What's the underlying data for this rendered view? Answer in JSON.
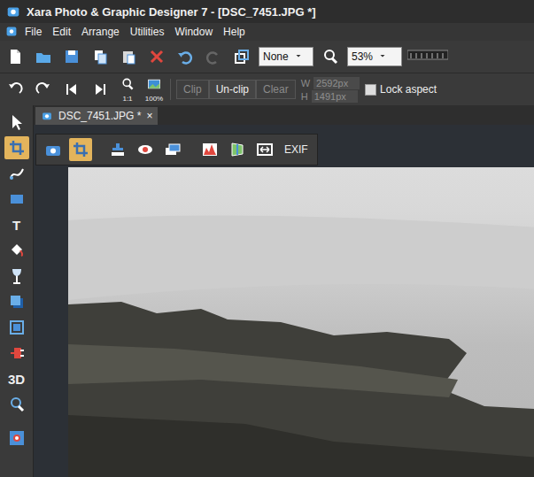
{
  "window": {
    "title": "Xara Photo & Graphic Designer 7 - [DSC_7451.JPG *]"
  },
  "menu": [
    "File",
    "Edit",
    "Arrange",
    "Utilities",
    "Window",
    "Help"
  ],
  "toolbar": {
    "quality": "None",
    "zoom": "53%"
  },
  "photo_bar": {
    "nav_labels": [
      "1:1",
      "100%"
    ],
    "buttons": [
      {
        "label": "Clip",
        "disabled": true
      },
      {
        "label": "Un-clip",
        "disabled": false
      },
      {
        "label": "Clear",
        "disabled": true
      }
    ],
    "width": {
      "label": "W",
      "value": "2592px"
    },
    "height": {
      "label": "H",
      "value": "1491px"
    },
    "lock_aspect": {
      "label": "Lock aspect",
      "checked": false
    }
  },
  "tools": [
    {
      "kind": "selector",
      "selected": false
    },
    {
      "kind": "photo",
      "selected": true
    },
    {
      "kind": "freehand",
      "selected": false
    },
    {
      "kind": "rectangle",
      "selected": false
    },
    {
      "kind": "text",
      "label": "T",
      "selected": false
    },
    {
      "kind": "fill",
      "selected": false
    },
    {
      "kind": "transparency",
      "selected": false
    },
    {
      "kind": "shadow",
      "selected": false
    },
    {
      "kind": "contour",
      "selected": false
    },
    {
      "kind": "mould",
      "selected": false
    },
    {
      "kind": "extrude",
      "label": "3D",
      "selected": false
    },
    {
      "kind": "zoom",
      "selected": false
    },
    {
      "kind": "live",
      "selected": false
    }
  ],
  "document_tabs": [
    {
      "label": "DSC_7451.JPG *",
      "close": "×",
      "selected": true
    }
  ],
  "sub_toolbar": {
    "buttons": [
      {
        "kind": "camera",
        "selected": false
      },
      {
        "kind": "crop",
        "selected": true
      },
      {
        "kind": "clone",
        "selected": false
      },
      {
        "kind": "redeye",
        "selected": false
      },
      {
        "kind": "panorama",
        "selected": false
      },
      {
        "kind": "levels",
        "selected": false
      },
      {
        "kind": "perspective",
        "selected": false
      },
      {
        "kind": "resize",
        "selected": false
      }
    ],
    "exif": "EXIF"
  }
}
